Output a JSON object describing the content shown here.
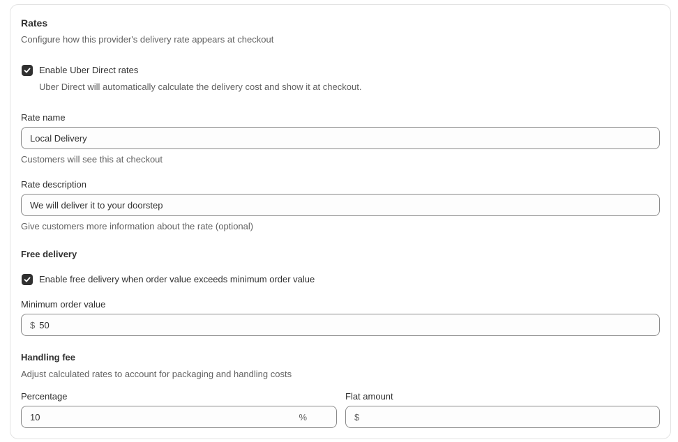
{
  "rates": {
    "title": "Rates",
    "subtitle": "Configure how this provider's delivery rate appears at checkout",
    "enable_checkbox": {
      "checked": true,
      "label": "Enable Uber Direct rates"
    },
    "enable_help": "Uber Direct will automatically calculate the delivery cost and show it at checkout."
  },
  "rate_name": {
    "label": "Rate name",
    "value": "Local Delivery",
    "help": "Customers will see this at checkout"
  },
  "rate_description": {
    "label": "Rate description",
    "value": "We will deliver it to your doorstep",
    "help": "Give customers more information about the rate (optional)"
  },
  "free_delivery": {
    "title": "Free delivery",
    "checkbox": {
      "checked": true,
      "label": "Enable free delivery when order value exceeds minimum order value"
    },
    "minimum": {
      "label": "Minimum order value",
      "prefix": "$",
      "value": "50"
    }
  },
  "handling_fee": {
    "title": "Handling fee",
    "subtitle": "Adjust calculated rates to account for packaging and handling costs",
    "percentage": {
      "label": "Percentage",
      "value": "10",
      "suffix": "%"
    },
    "flat": {
      "label": "Flat amount",
      "prefix": "$",
      "value": ""
    }
  },
  "colors": {
    "checkbox": "#303030",
    "border": "#8a8a8a",
    "help_text": "#616161"
  }
}
